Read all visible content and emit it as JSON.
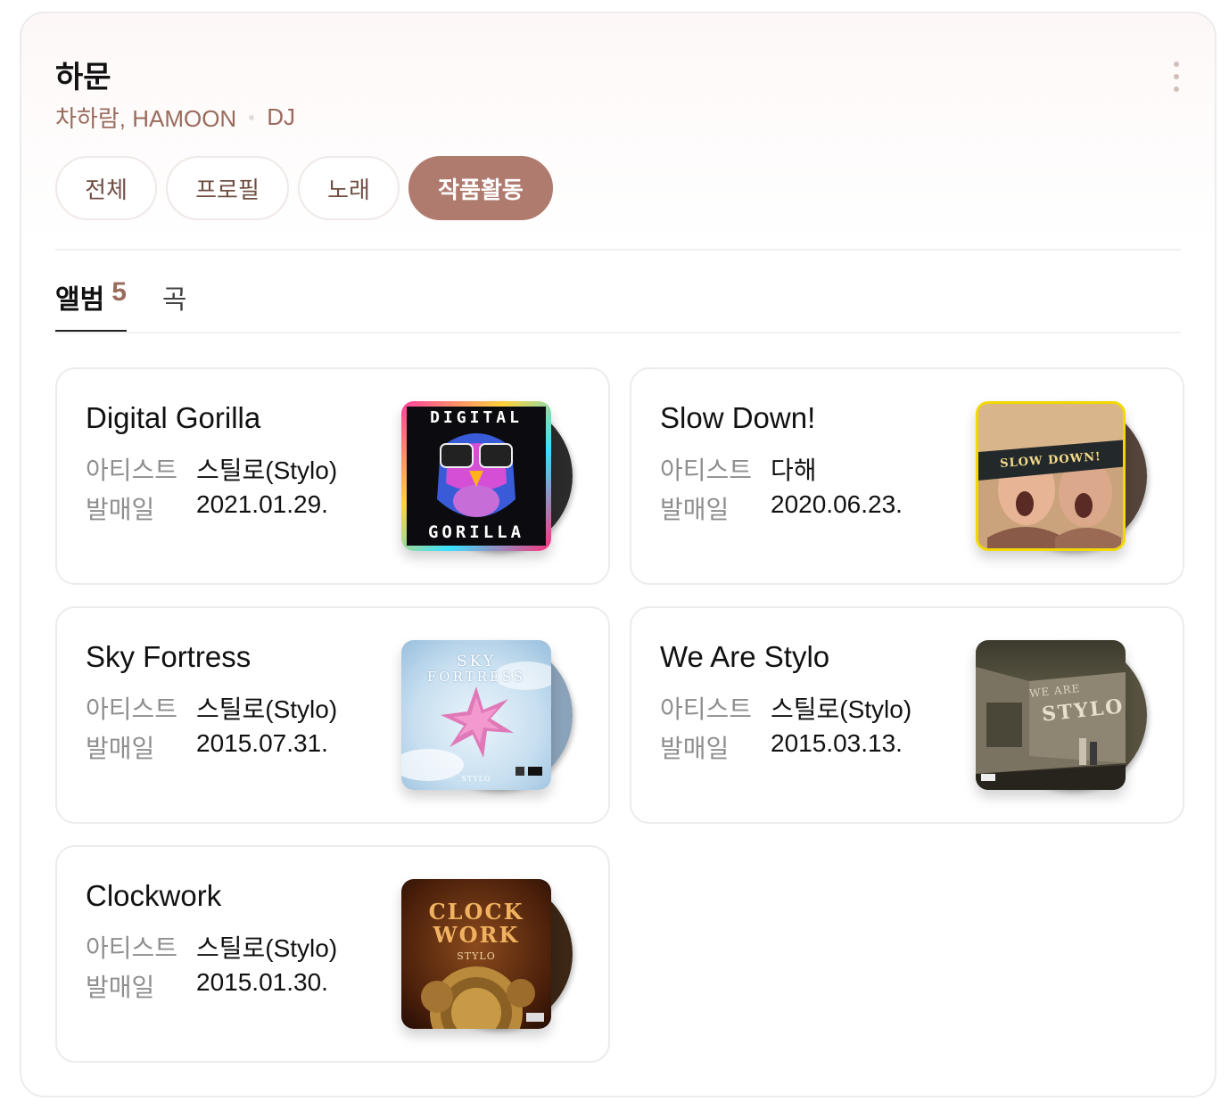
{
  "header": {
    "title": "하문",
    "subtitle_names": "차하람, HAMOON",
    "subtitle_role": "DJ",
    "more_icon": "more-vertical-icon"
  },
  "filters": [
    {
      "label": "전체",
      "active": false
    },
    {
      "label": "프로필",
      "active": false
    },
    {
      "label": "노래",
      "active": false
    },
    {
      "label": "작품활동",
      "active": true
    }
  ],
  "tabs": [
    {
      "label": "앨범",
      "count": "5",
      "active": true
    },
    {
      "label": "곡",
      "active": false
    }
  ],
  "labels": {
    "artist": "아티스트",
    "release": "발매일"
  },
  "albums": [
    {
      "title": "Digital Gorilla",
      "artist": "스틸로(Stylo)",
      "date": "2021.01.29.",
      "cover_text_top": "DIGITAL",
      "cover_text_bottom": "GORILLA"
    },
    {
      "title": "Slow Down!",
      "artist": "다해",
      "date": "2020.06.23.",
      "cover_text": "SLOW DOWN!"
    },
    {
      "title": "Sky Fortress",
      "artist": "스틸로(Stylo)",
      "date": "2015.07.31.",
      "cover_text_top": "SKY",
      "cover_text_bottom": "FORTRESS",
      "cover_brand": "STYLO"
    },
    {
      "title": "We Are Stylo",
      "artist": "스틸로(Stylo)",
      "date": "2015.03.13.",
      "cover_text_top": "WE ARE",
      "cover_text_bottom": "STYLO"
    },
    {
      "title": "Clockwork",
      "artist": "스틸로(Stylo)",
      "date": "2015.01.30.",
      "cover_text_top": "CLOCK",
      "cover_text_bottom": "WORK",
      "cover_brand": "STYLO"
    }
  ],
  "colors": {
    "accent": "#b07b6f",
    "subtitle": "#9a6b5c"
  }
}
